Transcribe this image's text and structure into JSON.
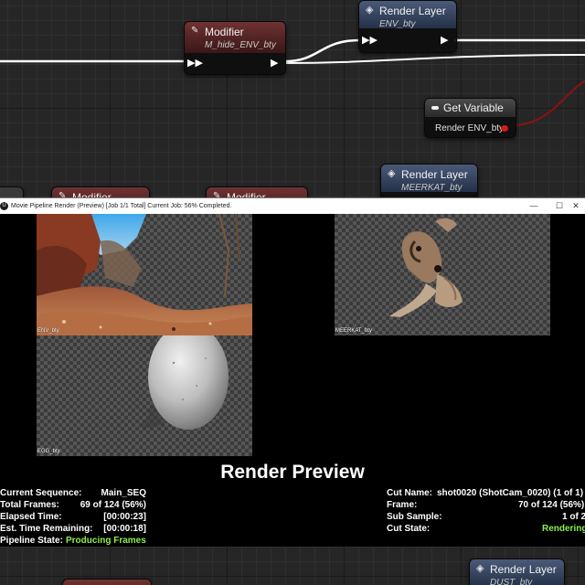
{
  "graph": {
    "nodes": {
      "modifier_top": {
        "title": "Modifier",
        "subtitle": "M_hide_ENV_bty"
      },
      "layer_env": {
        "title": "Render Layer",
        "subtitle": "ENV_bty"
      },
      "get_variable": {
        "title": "Get Variable",
        "variable": "Render ENV_bty"
      },
      "layer_meerkat": {
        "title": "Render Layer",
        "subtitle": "MEERKAT_bty"
      },
      "modifier_left": {
        "title": "Modifier"
      },
      "modifier_mid": {
        "title": "Modifier"
      },
      "layer_dust": {
        "title": "Render Layer",
        "subtitle": "DUST_bty"
      }
    },
    "colors": {
      "exec_wire": "#ffffff",
      "data_wire": "#8a1313",
      "modifier_header": "#6f3232",
      "layer_header": "#4a5a78"
    }
  },
  "window": {
    "title": "Movie Pipeline Render (Preview) [Job 1/1 Total] Current Job: 56% Completed.",
    "controls": {
      "minimize": "—",
      "maximize": "☐",
      "close": "✕"
    },
    "tiles": [
      {
        "label": "ENV_bty"
      },
      {
        "label": "MEERKAT_bty"
      },
      {
        "label": "EGG_bty"
      }
    ],
    "heading": "Render Preview",
    "left_stats": [
      {
        "key": "Current Sequence:",
        "value": "Main_SEQ"
      },
      {
        "key": "Total Frames:",
        "value": "69 of 124 (56%)"
      },
      {
        "key": "Elapsed Time:",
        "value": "[00:00:23]"
      },
      {
        "key": "Est. Time Remaining:",
        "value": "[00:00:18]"
      },
      {
        "key": "Pipeline State:",
        "value": "Producing Frames"
      }
    ],
    "right_stats": [
      {
        "key": "Cut Name:",
        "value": "shot0020 (ShotCam_0020) (1 of 1)"
      },
      {
        "key": "Frame:",
        "value": "70 of 124 (56%)"
      },
      {
        "key": "Sub Sample:",
        "value": "1 of 2"
      },
      {
        "key": "Cut State:",
        "value": "Rendering"
      }
    ],
    "progress_fraction": 0.56,
    "accent_green": "#8cf04d"
  },
  "icons": [
    "pencil-icon",
    "layers-icon",
    "exec-pin-icon",
    "variable-pin-icon",
    "app-icon"
  ]
}
